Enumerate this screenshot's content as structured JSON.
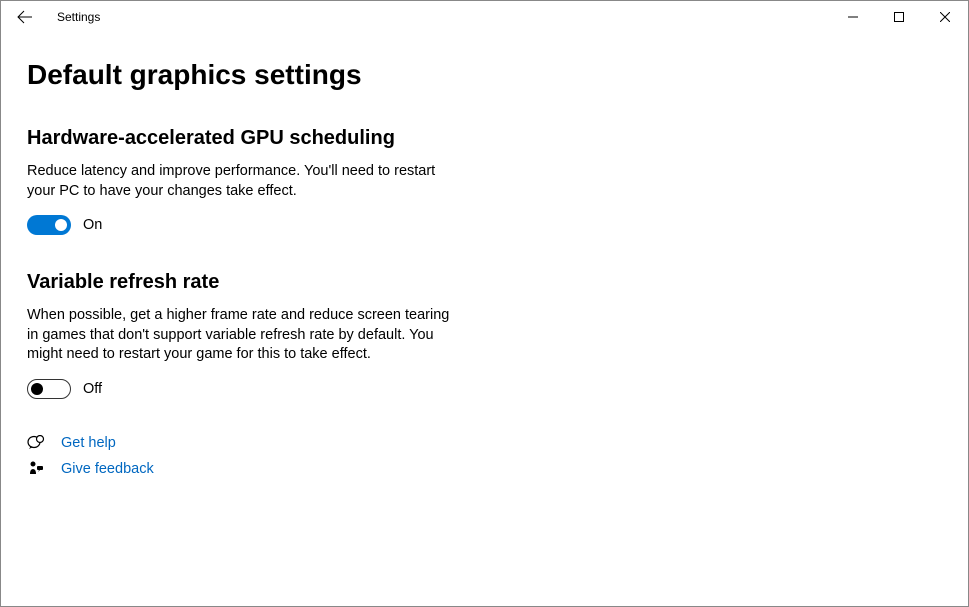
{
  "window": {
    "title": "Settings"
  },
  "page": {
    "heading": "Default graphics settings"
  },
  "sections": {
    "gpu": {
      "heading": "Hardware-accelerated GPU scheduling",
      "body": "Reduce latency and improve performance. You'll need to restart your PC to have your changes take effect.",
      "toggle_state": "On"
    },
    "vrr": {
      "heading": "Variable refresh rate",
      "body": "When possible, get a higher frame rate and reduce screen tearing in games that don't support variable refresh rate by default. You might need to restart your game for this to take effect.",
      "toggle_state": "Off"
    }
  },
  "links": {
    "help": "Get help",
    "feedback": "Give feedback"
  }
}
